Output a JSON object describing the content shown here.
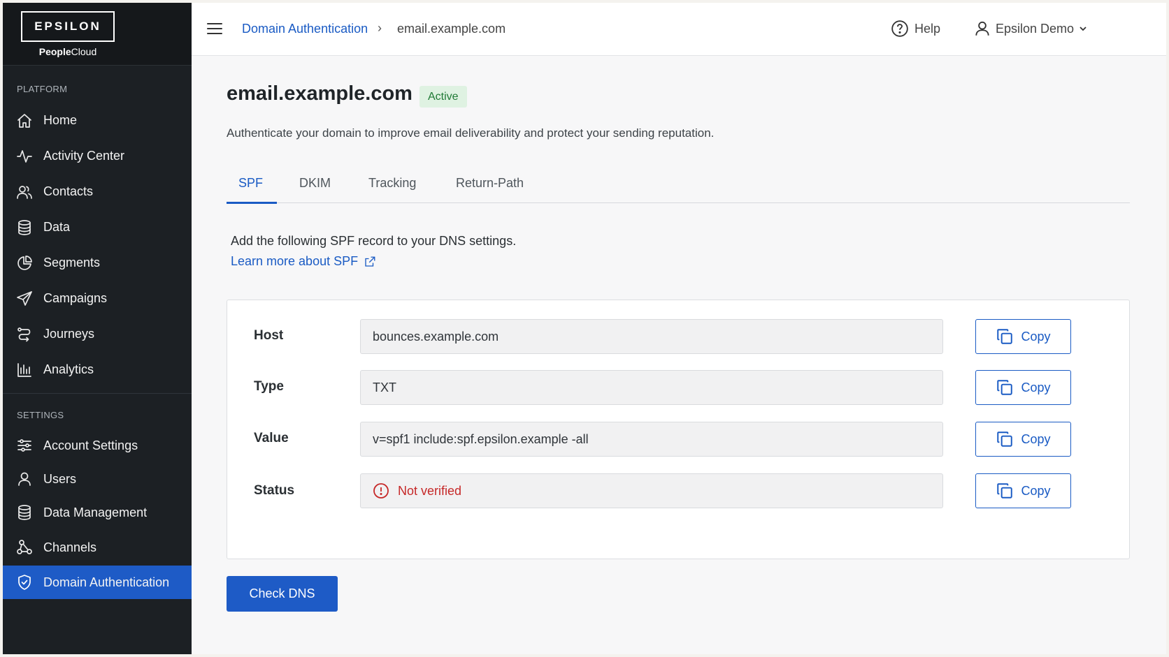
{
  "brand": {
    "logo": "EPSILON",
    "sub_bold": "People",
    "sub_light": "Cloud"
  },
  "sidebar": {
    "platform_label": "PLATFORM",
    "platform_items": [
      {
        "label": "Home",
        "icon": "home-icon"
      },
      {
        "label": "Activity Center",
        "icon": "activity-icon"
      },
      {
        "label": "Contacts",
        "icon": "contacts-icon"
      },
      {
        "label": "Data",
        "icon": "database-icon"
      },
      {
        "label": "Segments",
        "icon": "pie-chart-icon"
      },
      {
        "label": "Campaigns",
        "icon": "send-icon"
      },
      {
        "label": "Journeys",
        "icon": "journey-icon"
      },
      {
        "label": "Analytics",
        "icon": "bar-chart-icon"
      }
    ],
    "settings_label": "SETTINGS",
    "settings_items": [
      {
        "label": "Account Settings",
        "icon": "sliders-icon"
      },
      {
        "label": "Users",
        "icon": "user-icon"
      },
      {
        "label": "Data Management",
        "icon": "database-icon"
      },
      {
        "label": "Channels",
        "icon": "channels-icon"
      },
      {
        "label": "Domain Authentication",
        "icon": "shield-check-icon",
        "active": true
      }
    ]
  },
  "topbar": {
    "breadcrumb_parent": "Domain Authentication",
    "breadcrumb_sep": "›",
    "breadcrumb_current": "email.example.com",
    "help_label": "Help",
    "user_label": "Epsilon Demo"
  },
  "main": {
    "title": "email.example.com",
    "status_badge": "Active",
    "description": "Authenticate your domain to improve email deliverability and protect your sending reputation.",
    "tabs": [
      "SPF",
      "DKIM",
      "Tracking",
      "Return-Path"
    ],
    "active_tab": "SPF",
    "instruction": "Add the following SPF record to your DNS settings.",
    "learn_more": "Learn more about SPF",
    "records": {
      "host_label": "Host",
      "host_value": "bounces.example.com",
      "type_label": "Type",
      "type_value": "TXT",
      "value_label": "Value",
      "value_value": "v=spf1 include:spf.epsilon.example -all",
      "status_label": "Status",
      "status_value": "Not verified",
      "copy_label": "Copy"
    },
    "check_dns": "Check DNS"
  },
  "colors": {
    "accent": "#1e5bc6",
    "sidebar_bg": "#1c2024",
    "success": "#1f7a35",
    "error": "#c62828"
  }
}
